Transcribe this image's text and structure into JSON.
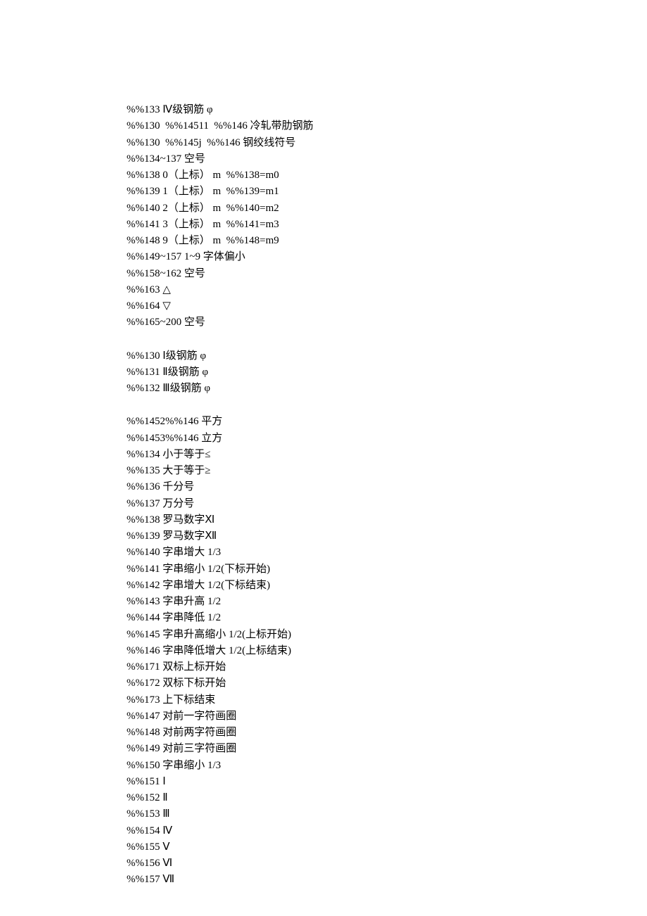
{
  "lines": [
    "%%133 Ⅳ级钢筋 φ",
    "%%130  %%14511  %%146 冷轧带肋钢筋",
    "%%130  %%145j  %%146 钢绞线符号",
    "%%134~137 空号",
    "%%138 0（上标） m  %%138=m0",
    "%%139 1（上标） m  %%139=m1",
    "%%140 2（上标） m  %%140=m2",
    "%%141 3（上标） m  %%141=m3",
    "%%148 9（上标） m  %%148=m9",
    "%%149~157 1~9 字体偏小",
    "%%158~162 空号",
    "%%163 △",
    "%%164 ▽",
    "%%165~200 空号",
    "",
    "%%130 Ⅰ级钢筋 φ",
    "%%131 Ⅱ级钢筋 φ",
    "%%132 Ⅲ级钢筋 φ",
    "",
    "%%1452%%146 平方",
    "%%1453%%146 立方",
    "%%134 小于等于≤",
    "%%135 大于等于≥",
    "%%136 千分号",
    "%%137 万分号",
    "%%138 罗马数字Ⅺ",
    "%%139 罗马数字Ⅻ",
    "%%140 字串增大 1/3",
    "%%141 字串缩小 1/2(下标开始)",
    "%%142 字串增大 1/2(下标结束)",
    "%%143 字串升高 1/2",
    "%%144 字串降低 1/2",
    "%%145 字串升高缩小 1/2(上标开始)",
    "%%146 字串降低增大 1/2(上标结束)",
    "%%171 双标上标开始",
    "%%172 双标下标开始",
    "%%173 上下标结束",
    "%%147 对前一字符画圈",
    "%%148 对前两字符画圈",
    "%%149 对前三字符画圈",
    "%%150 字串缩小 1/3",
    "%%151 Ⅰ",
    "%%152 Ⅱ",
    "%%153 Ⅲ",
    "%%154 Ⅳ",
    "%%155 Ⅴ",
    "%%156 Ⅵ",
    "%%157 Ⅶ"
  ]
}
